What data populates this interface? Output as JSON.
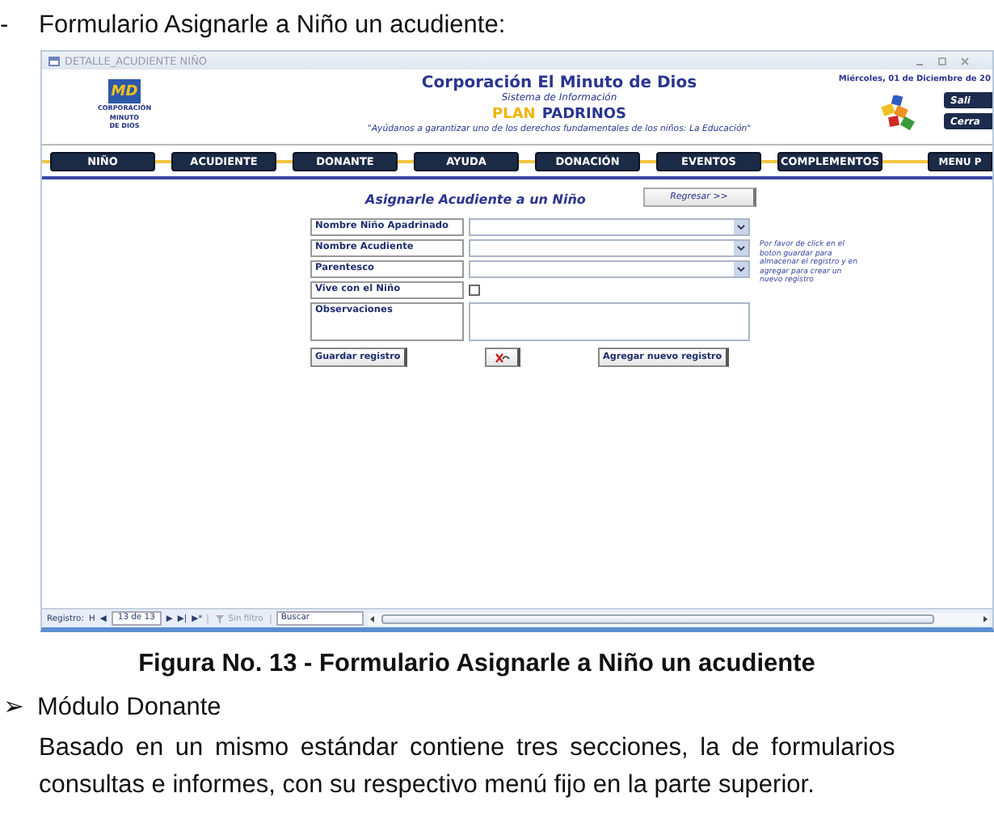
{
  "heading": {
    "bullet": "-",
    "text": "Formulario Asignarle a Niño un acudiente:"
  },
  "window": {
    "title": "DETALLE_ACUDIENTE  NIÑO",
    "header": {
      "logo": {
        "mark": "MD",
        "lines": [
          "CORPORACIÓN",
          "MINUTO",
          "DE DIOS"
        ]
      },
      "org": "Corporación El Minuto de Dios",
      "system": "Sistema de Información",
      "plan": "PLAN",
      "padrinos": "PADRINOS",
      "motto": "\"Ayúdanos a garantizar uno de los derechos fundamentales de los niños: La Educación\"",
      "date": "Miércoles, 01 de Diciembre de 20",
      "buttons": [
        "Sali",
        "Cerra"
      ]
    },
    "menu": [
      "NIÑO",
      "ACUDIENTE",
      "DONANTE",
      "AYUDA",
      "DONACIÓN",
      "EVENTOS",
      "COMPLEMENTOS",
      "MENU P"
    ],
    "form": {
      "title": "Asignarle Acudiente a un Niño",
      "back_button": "Regresar >>",
      "fields": [
        {
          "kind": "combo",
          "label": "Nombre Niño Apadrinado"
        },
        {
          "kind": "combo",
          "label": "Nombre Acudiente"
        },
        {
          "kind": "combo",
          "label": "Parentesco"
        },
        {
          "kind": "checkbox",
          "label": "Vive con el Niño",
          "checked": false
        },
        {
          "kind": "memo",
          "label": "Observaciones"
        }
      ],
      "hint": "Por favor de click en el boton guardar para almacenar el registro y en agregar para crear un nuevo registro",
      "save_button": "Guardar registro",
      "add_button": "Agregar nuevo registro"
    },
    "status_bar": {
      "label": "Registro:",
      "first": "H",
      "prev": "◀",
      "position": "13 de 13",
      "next": "▶",
      "last": "▶|",
      "new": "▶*",
      "filter": "Sin filtro",
      "search": "Buscar"
    }
  },
  "caption": "Figura No. 13 - Formulario Asignarle a Niño un acudiente",
  "section": {
    "bullet": "➢",
    "title": "Módulo Donante"
  },
  "paragraph": [
    "Basado en un mismo estándar contiene tres secciones, la de formularios",
    "consultas e informes, con su respectivo menú fijo en la parte superior."
  ]
}
